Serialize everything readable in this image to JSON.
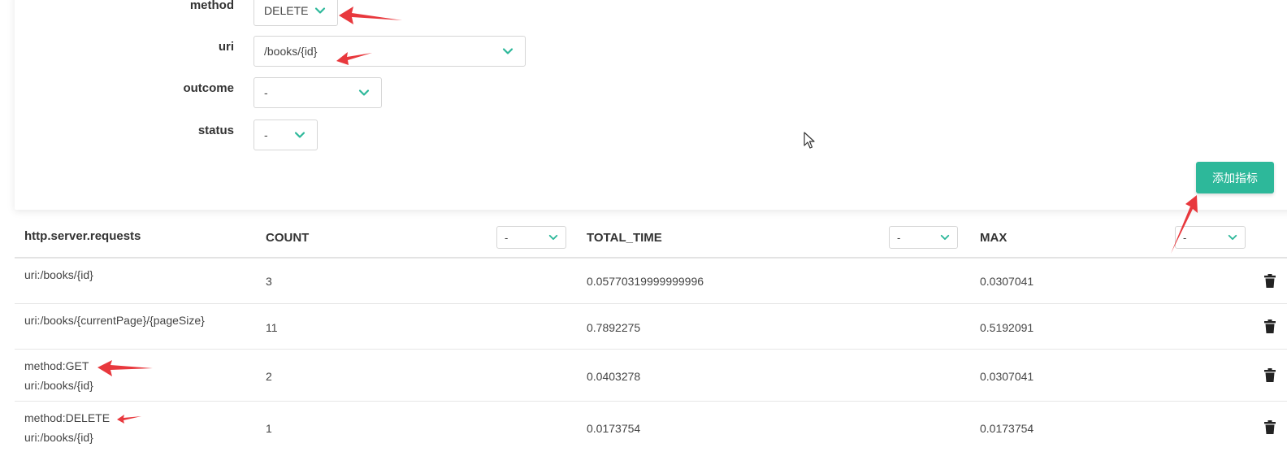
{
  "filters": {
    "method": {
      "label": "method",
      "value": "DELETE"
    },
    "uri": {
      "label": "uri",
      "value": "/books/{id}"
    },
    "outcome": {
      "label": "outcome",
      "value": "-"
    },
    "status": {
      "label": "status",
      "value": "-"
    }
  },
  "add_button_label": "添加指标",
  "table": {
    "headers": {
      "name": "http.server.requests",
      "count": "COUNT",
      "total_time": "TOTAL_TIME",
      "max": "MAX"
    },
    "column_selects": {
      "count": "-",
      "total_time": "-",
      "max": "-"
    },
    "rows": [
      {
        "tags": [
          "uri:/books/{id}"
        ],
        "count": "3",
        "total_time": "0.05770319999999996",
        "max": "0.0307041"
      },
      {
        "tags": [
          "uri:/books/{currentPage}/{pageSize}"
        ],
        "count": "11",
        "total_time": "0.7892275",
        "max": "0.5192091"
      },
      {
        "tags": [
          "method:GET",
          "uri:/books/{id}"
        ],
        "count": "2",
        "total_time": "0.0403278",
        "max": "0.0307041"
      },
      {
        "tags": [
          "method:DELETE",
          "uri:/books/{id}"
        ],
        "count": "1",
        "total_time": "0.0173754",
        "max": "0.0173754"
      }
    ]
  },
  "icons": {
    "dropdown": "chevron-down-icon",
    "delete": "trash-icon",
    "pointer": "cursor-icon",
    "annotation": "red-arrow-icon"
  },
  "colors": {
    "accent": "#2db89a",
    "annotation": "#e8383d"
  }
}
